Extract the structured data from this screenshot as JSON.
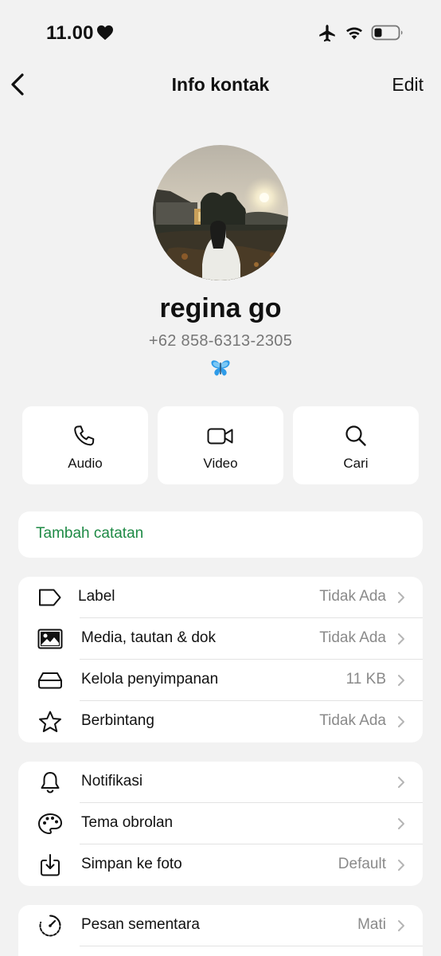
{
  "status_bar": {
    "time": "11.00",
    "icons": [
      "heart-icon",
      "airplane-icon",
      "wifi-icon",
      "battery-icon"
    ]
  },
  "nav": {
    "title": "Info kontak",
    "edit_label": "Edit",
    "back_icon": "chevron-left-icon"
  },
  "profile": {
    "name": "regina go",
    "phone": "+62 858-6313-2305",
    "emoji_icon": "butterfly-icon"
  },
  "actions": [
    {
      "label": "Audio",
      "icon": "phone-icon"
    },
    {
      "label": "Video",
      "icon": "video-camera-icon"
    },
    {
      "label": "Cari",
      "icon": "search-icon"
    }
  ],
  "note": {
    "label": "Tambah catatan",
    "color": "#1e8a45"
  },
  "list1": [
    {
      "label": "Label",
      "value": "Tidak Ada",
      "icon": "label-tag-icon"
    },
    {
      "label": "Media, tautan & dok",
      "value": "Tidak Ada",
      "icon": "image-icon"
    },
    {
      "label": "Kelola penyimpanan",
      "value": "11 KB",
      "icon": "storage-drive-icon"
    },
    {
      "label": "Berbintang",
      "value": "Tidak Ada",
      "icon": "star-icon"
    }
  ],
  "list2": [
    {
      "label": "Notifikasi",
      "value": "",
      "icon": "bell-icon"
    },
    {
      "label": "Tema obrolan",
      "value": "",
      "icon": "palette-icon"
    },
    {
      "label": "Simpan ke foto",
      "value": "Default",
      "icon": "save-download-icon"
    }
  ],
  "list3": [
    {
      "label": "Pesan sementara",
      "value": "Mati",
      "icon": "timer-icon"
    }
  ]
}
